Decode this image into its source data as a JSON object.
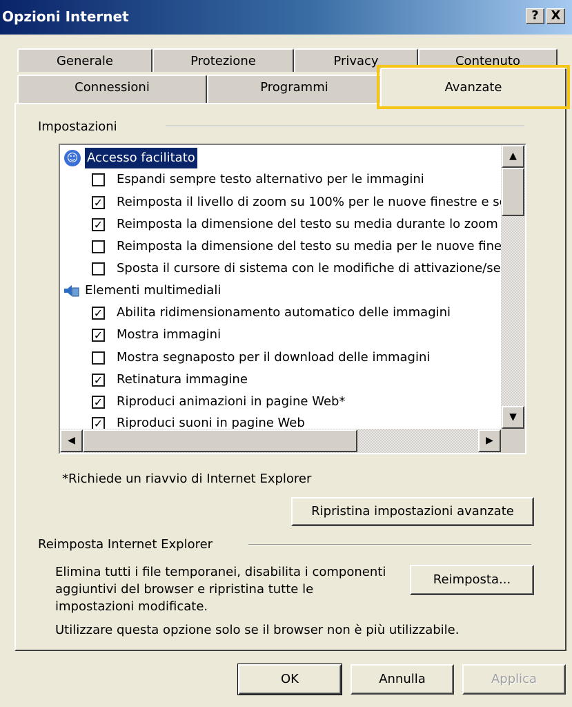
{
  "window": {
    "title": "Opzioni Internet",
    "help": "?",
    "close": "X"
  },
  "tabs": {
    "row1": [
      "Generale",
      "Protezione",
      "Privacy",
      "Contenuto"
    ],
    "row2": [
      "Connessioni",
      "Programmi",
      "Avanzate"
    ],
    "active": "Avanzate"
  },
  "settings": {
    "label": "Impostazioni",
    "categories": [
      {
        "label": "Accesso facilitato",
        "items": [
          {
            "label": "Espandi sempre testo alternativo per le immagini",
            "checked": false
          },
          {
            "label": "Reimposta il livello di zoom su 100% per le nuove finestre e schede",
            "checked": true
          },
          {
            "label": "Reimposta la dimensione del testo su media durante lo zoom",
            "checked": true
          },
          {
            "label": "Reimposta la dimensione del testo su media per le nuove finestre e schede",
            "checked": false
          },
          {
            "label": "Sposta il cursore di sistema con le modifiche di attivazione/selezione",
            "checked": false
          }
        ]
      },
      {
        "label": "Elementi multimediali",
        "items": [
          {
            "label": "Abilita ridimensionamento automatico delle immagini",
            "checked": true
          },
          {
            "label": "Mostra immagini",
            "checked": true
          },
          {
            "label": "Mostra segnaposto per il download delle immagini",
            "checked": false
          },
          {
            "label": "Retinatura immagine",
            "checked": true
          },
          {
            "label": "Riproduci animazioni in pagine Web*",
            "checked": true
          },
          {
            "label": "Riproduci suoni in pagine Web",
            "checked": true
          }
        ]
      }
    ],
    "restart_note": "*Richiede un riavvio di Internet Explorer",
    "restore_button": "Ripristina impostazioni avanzate"
  },
  "reset": {
    "label": "Reimposta Internet Explorer",
    "description": [
      "Elimina tutti i file temporanei, disabilita i componenti",
      "aggiuntivi del browser e ripristina tutte le",
      "impostazioni modificate."
    ],
    "warning": "Utilizzare questa opzione solo se il browser non è più utilizzabile.",
    "button": "Reimposta..."
  },
  "footer": {
    "ok": "OK",
    "cancel": "Annulla",
    "apply": "Applica"
  },
  "colors": {
    "highlight": "#f5c518",
    "selection": "#0a246a",
    "titlebar": "#0a246a"
  }
}
